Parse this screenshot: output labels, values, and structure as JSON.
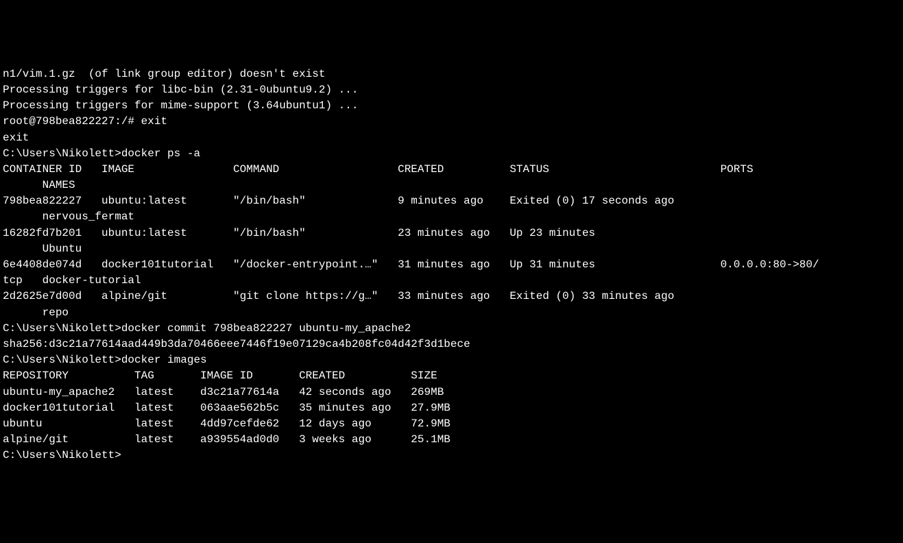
{
  "lines": {
    "l0": "n1/vim.1.gz  (of link group editor) doesn't exist",
    "l1": "Processing triggers for libc-bin (2.31-0ubuntu9.2) ...",
    "l2": "Processing triggers for mime-support (3.64ubuntu1) ...",
    "l3": "root@798bea822227:/# exit",
    "l4": "exit",
    "l5": "",
    "l6": "C:\\Users\\Nikolett>docker ps -a",
    "l7": "CONTAINER ID   IMAGE               COMMAND                  CREATED          STATUS                          PORTS",
    "l8": "      NAMES",
    "l9": "798bea822227   ubuntu:latest       \"/bin/bash\"              9 minutes ago    Exited (0) 17 seconds ago",
    "l10": "      nervous_fermat",
    "l11": "16282fd7b201   ubuntu:latest       \"/bin/bash\"              23 minutes ago   Up 23 minutes",
    "l12": "      Ubuntu",
    "l13": "6e4408de074d   docker101tutorial   \"/docker-entrypoint.…\"   31 minutes ago   Up 31 minutes                   0.0.0.0:80->80/",
    "l14": "tcp   docker-tutorial",
    "l15": "2d2625e7d00d   alpine/git          \"git clone https://g…\"   33 minutes ago   Exited (0) 33 minutes ago",
    "l16": "      repo",
    "l17": "",
    "l18": "C:\\Users\\Nikolett>docker commit 798bea822227 ubuntu-my_apache2",
    "l19": "sha256:d3c21a77614aad449b3da70466eee7446f19e07129ca4b208fc04d42f3d1bece",
    "l20": "",
    "l21": "C:\\Users\\Nikolett>docker images",
    "l22": "REPOSITORY          TAG       IMAGE ID       CREATED          SIZE",
    "l23": "ubuntu-my_apache2   latest    d3c21a77614a   42 seconds ago   269MB",
    "l24": "docker101tutorial   latest    063aae562b5c   35 minutes ago   27.9MB",
    "l25": "ubuntu              latest    4dd97cefde62   12 days ago      72.9MB",
    "l26": "alpine/git          latest    a939554ad0d0   3 weeks ago      25.1MB",
    "l27": "",
    "l28": "C:\\Users\\Nikolett>"
  }
}
